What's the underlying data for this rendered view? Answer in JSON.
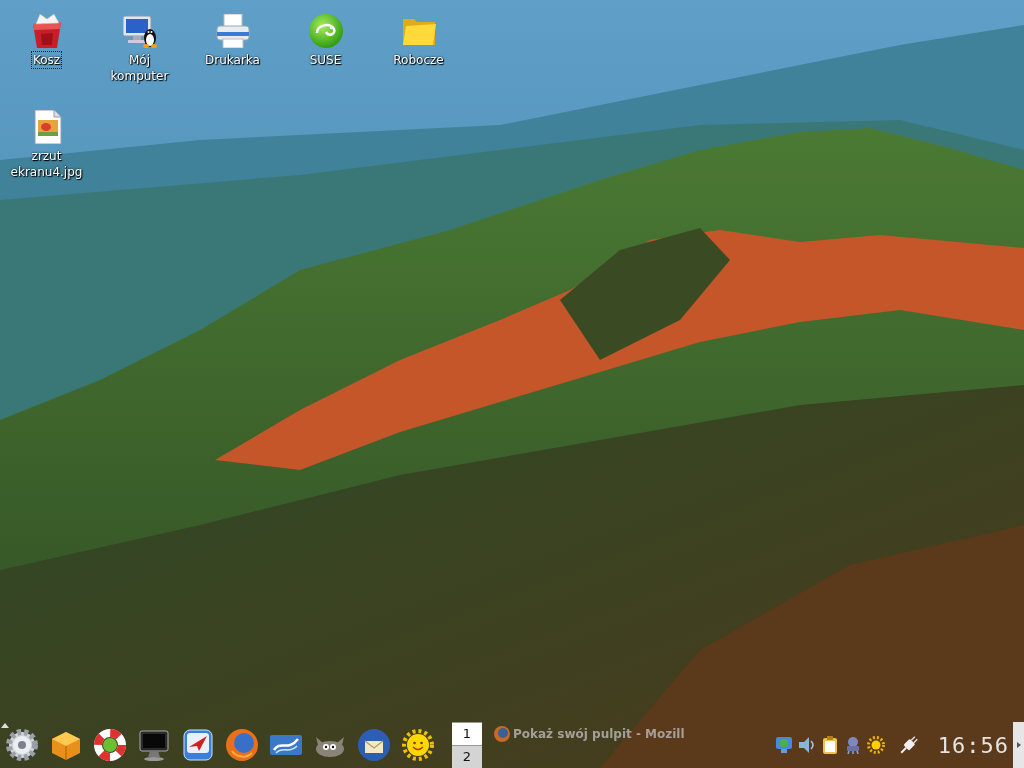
{
  "desktop": {
    "icons": [
      {
        "label": "Kosz",
        "selected": true
      },
      {
        "label": "Mój komputer",
        "selected": false
      },
      {
        "label": "Drukarka",
        "selected": false
      },
      {
        "label": "SUSE",
        "selected": false
      },
      {
        "label": "Robocze",
        "selected": false
      },
      {
        "label": "zrzut ekranu4.jpg",
        "selected": false
      }
    ]
  },
  "panel": {
    "pager": [
      {
        "label": "1",
        "selected": true
      },
      {
        "label": "2",
        "selected": false
      }
    ],
    "tasks": [
      {
        "title": "Pokaż swój pulpit - Mozill"
      }
    ],
    "clock": "16:56"
  }
}
